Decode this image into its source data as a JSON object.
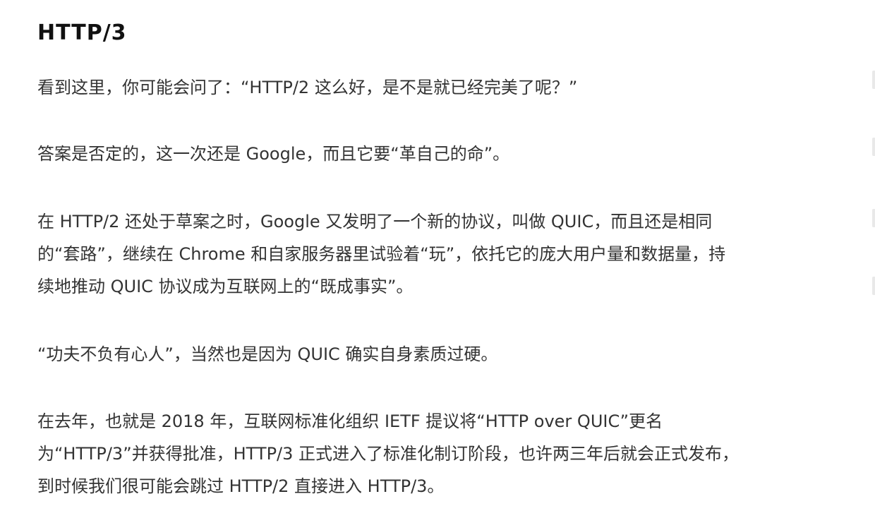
{
  "article": {
    "title": "HTTP/3",
    "paragraphs": [
      {
        "lines": [
          "看到这里，你可能会问了：“HTTP/2 这么好，是不是就已经完美了呢？”"
        ]
      },
      {
        "lines": [
          "答案是否定的，这一次还是 Google，而且它要“革自己的命”。"
        ]
      },
      {
        "lines": [
          "在 HTTP/2 还处于草案之时，Google 又发明了一个新的协议，叫做 QUIC，而且还是相同",
          "的“套路”，继续在 Chrome 和自家服务器里试验着“玩”，依托它的庞大用户量和数据量，持",
          "续地推动 QUIC 协议成为互联网上的“既成事实”。"
        ]
      },
      {
        "lines": [
          "“功夫不负有心人”，当然也是因为 QUIC 确实自身素质过硬。"
        ]
      },
      {
        "lines": [
          "在去年，也就是 2018 年，互联网标准化组织 IETF 提议将“HTTP over QUIC”更名",
          "为“HTTP/3”并获得批准，HTTP/3 正式进入了标准化制订阶段，也许两三年后就会正式发布，",
          "到时候我们很可能会跳过 HTTP/2 直接进入 HTTP/3。"
        ]
      }
    ]
  }
}
